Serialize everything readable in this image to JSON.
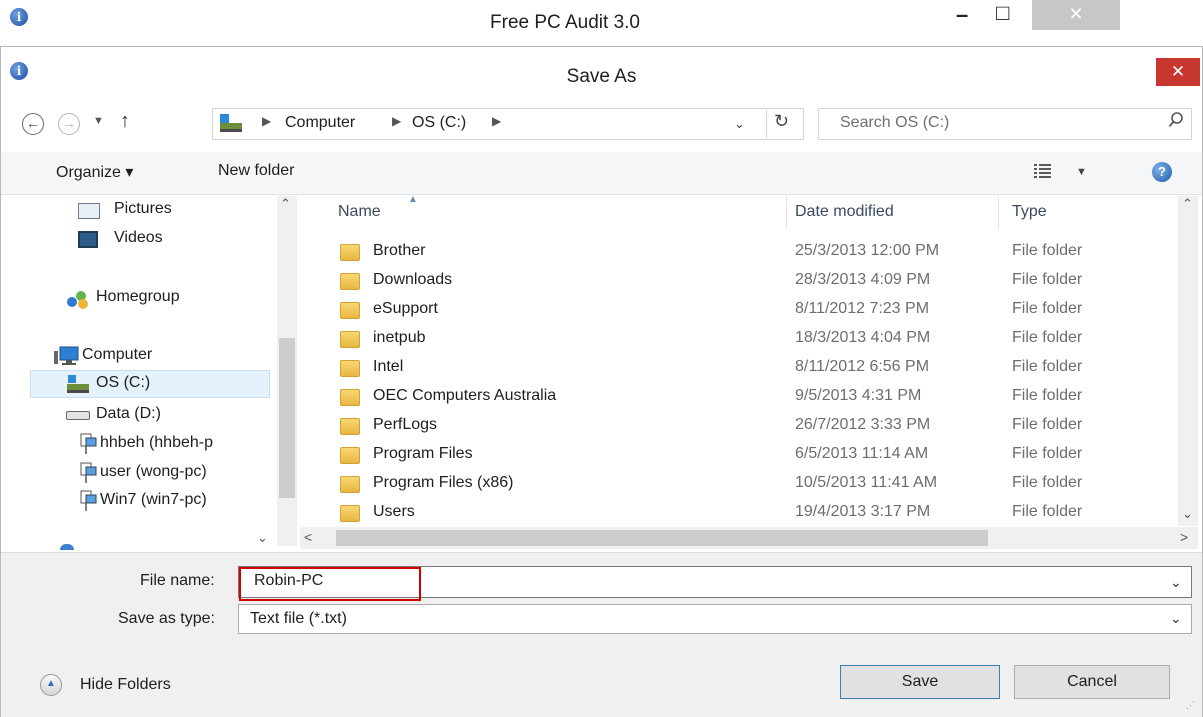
{
  "parent_window": {
    "title": "Free PC Audit 3.0",
    "minimize_glyph": "–",
    "maximize_glyph": "□",
    "close_glyph": "✕"
  },
  "dialog": {
    "title": "Save As",
    "close_glyph": "✕",
    "breadcrumb": [
      "Computer",
      "OS (C:)"
    ],
    "search_placeholder": "Search OS (C:)",
    "toolbar": {
      "organize_label": "Organize ▾",
      "new_folder_label": "New folder"
    },
    "nav_items": [
      {
        "label": "Pictures",
        "icon": "pictures-icon"
      },
      {
        "label": "Videos",
        "icon": "videos-icon"
      },
      {
        "label": "Homegroup",
        "icon": "homegroup-icon"
      },
      {
        "label": "Computer",
        "icon": "computer-icon"
      },
      {
        "label": "OS (C:)",
        "icon": "drive-c-icon",
        "selected": true
      },
      {
        "label": "Data (D:)",
        "icon": "drive-d-icon"
      },
      {
        "label": "hhbeh (hhbeh-p",
        "icon": "network-drive-icon"
      },
      {
        "label": "user (wong-pc)",
        "icon": "network-drive-icon"
      },
      {
        "label": "Win7 (win7-pc)",
        "icon": "network-drive-icon"
      }
    ],
    "columns": {
      "name": "Name",
      "date": "Date modified",
      "type": "Type"
    },
    "files": [
      {
        "name": "Brother",
        "date": "25/3/2013 12:00 PM",
        "type": "File folder"
      },
      {
        "name": "Downloads",
        "date": "28/3/2013 4:09 PM",
        "type": "File folder"
      },
      {
        "name": "eSupport",
        "date": "8/11/2012 7:23 PM",
        "type": "File folder"
      },
      {
        "name": "inetpub",
        "date": "18/3/2013 4:04 PM",
        "type": "File folder"
      },
      {
        "name": "Intel",
        "date": "8/11/2012 6:56 PM",
        "type": "File folder"
      },
      {
        "name": "OEC Computers Australia",
        "date": "9/5/2013 4:31 PM",
        "type": "File folder"
      },
      {
        "name": "PerfLogs",
        "date": "26/7/2012 3:33 PM",
        "type": "File folder"
      },
      {
        "name": "Program Files",
        "date": "6/5/2013 11:14 AM",
        "type": "File folder"
      },
      {
        "name": "Program Files (x86)",
        "date": "10/5/2013 11:41 AM",
        "type": "File folder"
      },
      {
        "name": "Users",
        "date": "19/4/2013 3:17 PM",
        "type": "File folder"
      }
    ],
    "file_name_label": "File name:",
    "file_name_value": "Robin-PC",
    "save_as_type_label": "Save as type:",
    "save_as_type_value": "Text file (*.txt)",
    "hide_folders_label": "Hide Folders",
    "save_label": "Save",
    "cancel_label": "Cancel"
  },
  "colors": {
    "accent": "#3c7fb1",
    "close_red": "#c7362f",
    "highlight_red": "#d40000",
    "selection": "#e5f1fb"
  }
}
